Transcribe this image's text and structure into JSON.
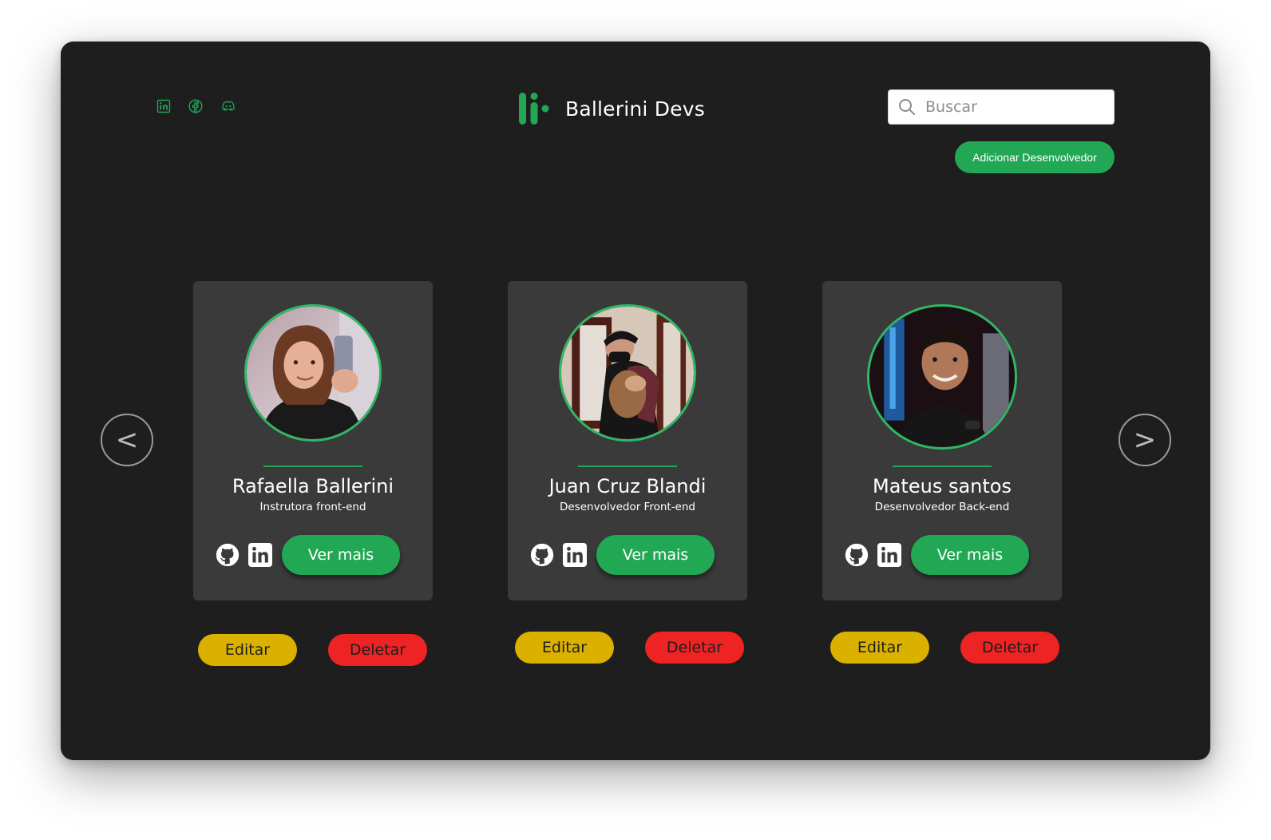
{
  "brand": {
    "title": "Ballerini Devs",
    "accent": "#22a855"
  },
  "header_socials": [
    {
      "icon": "linkedin-icon"
    },
    {
      "icon": "facebook-icon"
    },
    {
      "icon": "discord-icon"
    }
  ],
  "search": {
    "placeholder": "Buscar",
    "value": ""
  },
  "add_button": "Adicionar Desenvolvedor",
  "carousel": {
    "prev_label": "<",
    "next_label": ">"
  },
  "developers": [
    {
      "name": "Rafaella Ballerini",
      "role": "Instrutora front-end",
      "more_label": "Ver mais",
      "edit_label": "Editar",
      "delete_label": "Deletar"
    },
    {
      "name": "Juan Cruz Blandi",
      "role": "Desenvolvedor Front-end",
      "more_label": "Ver mais",
      "edit_label": "Editar",
      "delete_label": "Deletar"
    },
    {
      "name": "Mateus santos",
      "role": "Desenvolvedor Back-end",
      "more_label": "Ver mais",
      "edit_label": "Editar",
      "delete_label": "Deletar"
    }
  ],
  "colors": {
    "background": "#1e1e1e",
    "card": "#3a3a3a",
    "green": "#22a855",
    "edit": "#dbb100",
    "delete": "#ee2323"
  }
}
